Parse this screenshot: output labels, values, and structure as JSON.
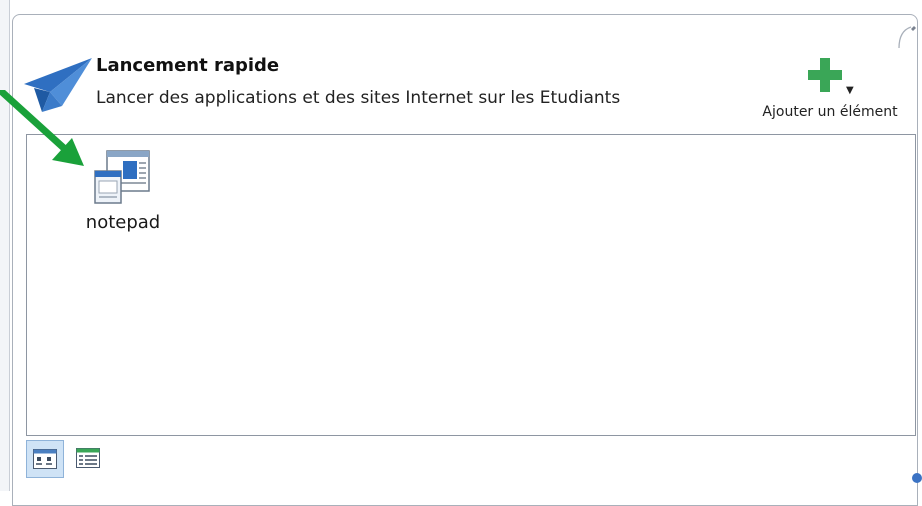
{
  "header": {
    "title": "Lancement rapide",
    "subtitle": "Lancer des applications et des sites Internet sur les Etudiants",
    "icon": "paper-plane-icon"
  },
  "toolbar": {
    "add_label": "Ajouter un élément",
    "add_icon": "plus-icon"
  },
  "items": [
    {
      "label": "notepad",
      "icon": "application-window-icon"
    }
  ],
  "view_modes": [
    {
      "name": "icons",
      "icon": "large-icons-view-icon",
      "active": true
    },
    {
      "name": "details",
      "icon": "details-list-view-icon",
      "active": false
    }
  ],
  "colors": {
    "accent_blue": "#2f6fc1",
    "plus_green": "#3aa657",
    "annotation_arrow": "#1aa13a"
  }
}
